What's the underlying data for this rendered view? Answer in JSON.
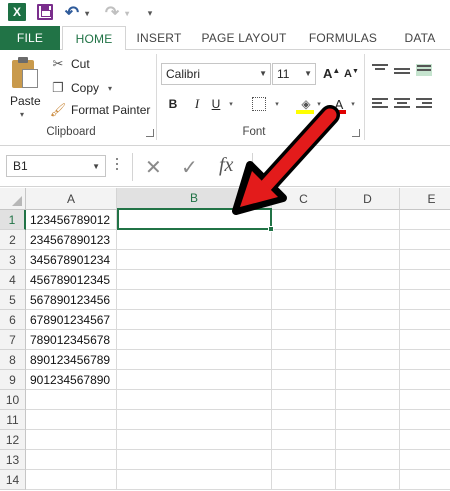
{
  "app": {
    "logo_text": "X",
    "accent_color": "#217346"
  },
  "quick_access": {
    "undo_glyph": "↶",
    "redo_glyph": "↷",
    "more_glyph": "▾",
    "dropdown_glyph": "▾"
  },
  "tabs": [
    {
      "label": "FILE"
    },
    {
      "label": "HOME"
    },
    {
      "label": "INSERT"
    },
    {
      "label": "PAGE LAYOUT"
    },
    {
      "label": "FORMULAS"
    },
    {
      "label": "DATA"
    }
  ],
  "clipboard": {
    "paste_label": "Paste",
    "cut_label": "Cut",
    "copy_label": "Copy",
    "format_painter_label": "Format Painter",
    "group_label": "Clipboard",
    "cut_icon": "✂",
    "copy_icon": "❐",
    "painter_icon": "🖌"
  },
  "font": {
    "name_value": "Calibri",
    "size_value": "11",
    "grow_label": "A",
    "shrink_label": "A",
    "bold_label": "B",
    "italic_label": "I",
    "underline_label": "U",
    "font_color_label": "A",
    "group_label": "Font",
    "fill_color": "#ffff00",
    "font_color": "#e00000"
  },
  "formula_bar": {
    "name_box_value": "B1",
    "cancel_glyph": "✕",
    "enter_glyph": "✓",
    "fx_label": "fx",
    "formula_value": ""
  },
  "sheet": {
    "columns": [
      "A",
      "B",
      "C",
      "D",
      "E"
    ],
    "rows": [
      "1",
      "2",
      "3",
      "4",
      "5",
      "6",
      "7",
      "8",
      "9",
      "10",
      "11",
      "12",
      "13",
      "14"
    ],
    "column_a_values": [
      "123456789012",
      "234567890123",
      "345678901234",
      "456789012345",
      "567890123456",
      "678901234567",
      "789012345678",
      "890123456789",
      "901234567890"
    ],
    "active_cell": "B1",
    "arrow_color": "#e31b1b"
  }
}
